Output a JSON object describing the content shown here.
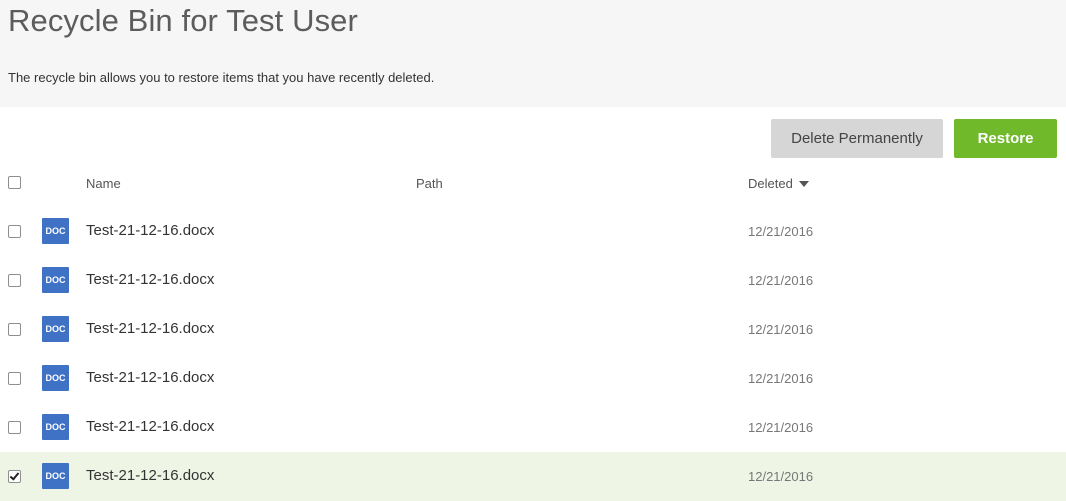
{
  "header": {
    "title": "Recycle Bin for Test User",
    "description": "The recycle bin allows you to restore items that you have recently deleted."
  },
  "toolbar": {
    "delete_label": "Delete Permanently",
    "restore_label": "Restore",
    "restore_color": "#6fb92a"
  },
  "table": {
    "columns": {
      "name": "Name",
      "path": "Path",
      "deleted": "Deleted"
    },
    "sort": {
      "column": "Deleted",
      "direction": "descending"
    },
    "rows": [
      {
        "icon": "DOC",
        "name": "Test-21-12-16.docx",
        "path": "",
        "deleted": "12/21/2016",
        "checked": false
      },
      {
        "icon": "DOC",
        "name": "Test-21-12-16.docx",
        "path": "",
        "deleted": "12/21/2016",
        "checked": false
      },
      {
        "icon": "DOC",
        "name": "Test-21-12-16.docx",
        "path": "",
        "deleted": "12/21/2016",
        "checked": false
      },
      {
        "icon": "DOC",
        "name": "Test-21-12-16.docx",
        "path": "",
        "deleted": "12/21/2016",
        "checked": false
      },
      {
        "icon": "DOC",
        "name": "Test-21-12-16.docx",
        "path": "",
        "deleted": "12/21/2016",
        "checked": false
      },
      {
        "icon": "DOC",
        "name": "Test-21-12-16.docx",
        "path": "",
        "deleted": "12/21/2016",
        "checked": true
      }
    ]
  }
}
